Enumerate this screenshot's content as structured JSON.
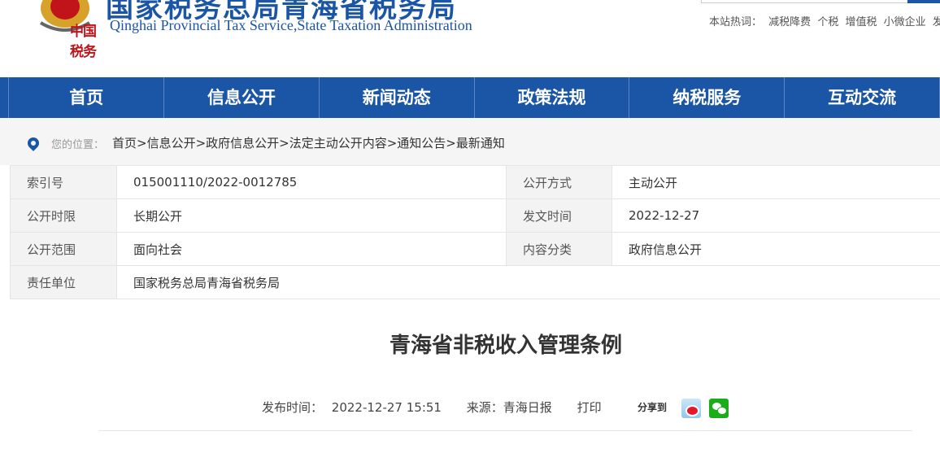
{
  "header": {
    "site_cn": "国家税务总局青海省税务局",
    "site_en": "Qinghai Provincial Tax Service,State Taxation Administration",
    "logo_text": "中国税务",
    "hot_label": "本站热词：",
    "hot_words": [
      "减税降费",
      "个税",
      "增值税",
      "小微企业",
      "发"
    ]
  },
  "nav": [
    "首页",
    "信息公开",
    "新闻动态",
    "政策法规",
    "纳税服务",
    "互动交流"
  ],
  "breadcrumb": {
    "label": "您的位置：",
    "path": "首页>信息公开>政府信息公开>法定主动公开内容>通知公告>最新通知"
  },
  "meta": [
    {
      "k1": "索引号",
      "v1": "015001110/2022-0012785",
      "k2": "公开方式",
      "v2": "主动公开"
    },
    {
      "k1": "公开时限",
      "v1": "长期公开",
      "k2": "发文时间",
      "v2": "2022-12-27"
    },
    {
      "k1": "公开范围",
      "v1": "面向社会",
      "k2": "内容分类",
      "v2": "政府信息公开"
    },
    {
      "k1": "责任单位",
      "v1": "国家税务总局青海省税务局"
    }
  ],
  "article": {
    "title": "青海省非税收入管理条例",
    "publish_label": "发布时间：",
    "publish_time": "2022-12-27 15:51",
    "source_label": "来源：",
    "source": "青海日报",
    "print": "打印",
    "share": "分享到"
  }
}
